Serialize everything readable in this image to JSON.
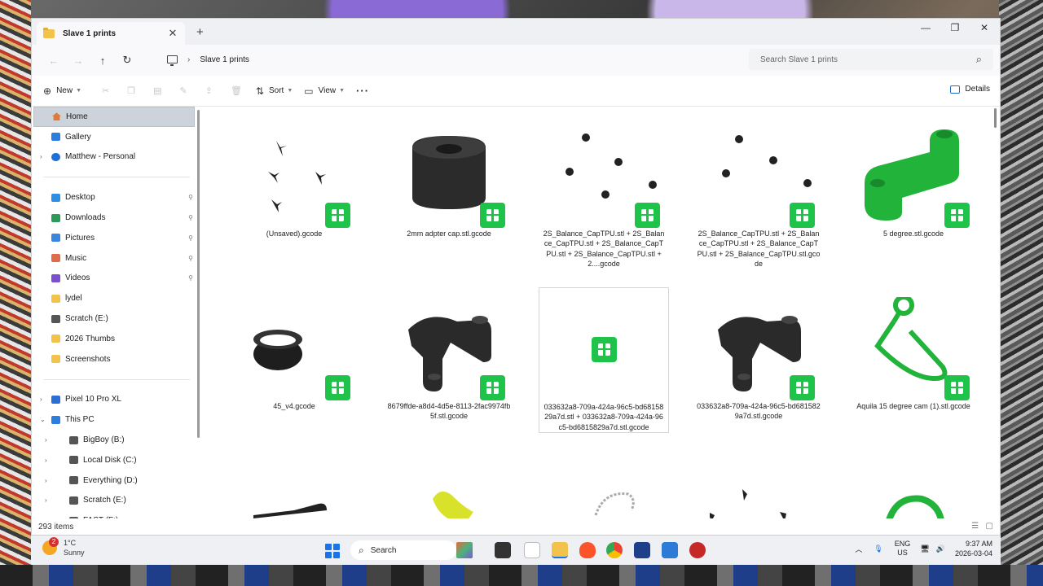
{
  "window": {
    "tab_title": "Slave 1 prints",
    "breadcrumb": "Slave 1 prints",
    "search_placeholder": "Search Slave 1 prints",
    "icons": {
      "tab_close": "✕",
      "new_tab": "+",
      "minimize": "—",
      "maximize": "❐",
      "close": "✕",
      "back": "←",
      "forward": "→",
      "up": "↑",
      "refresh": "↻",
      "search": "⌕"
    }
  },
  "toolbar": {
    "new_label": "New",
    "sort_label": "Sort",
    "view_label": "View",
    "more_label": "···",
    "details_label": "Details"
  },
  "sidebar": {
    "items": [
      {
        "label": "Home",
        "icon": "home-icon",
        "color": "#e07a3a"
      },
      {
        "label": "Gallery",
        "icon": "gallery-icon",
        "color": "#2b7de0"
      },
      {
        "label": "Matthew - Personal",
        "icon": "cloud-icon",
        "color": "#1f6fd6",
        "arrow": "›"
      }
    ],
    "quick": [
      {
        "label": "Desktop",
        "color": "#2e8ee6",
        "pin": "📌"
      },
      {
        "label": "Downloads",
        "color": "#2b9a5b",
        "pin": "📌"
      },
      {
        "label": "Pictures",
        "color": "#3a85e0",
        "pin": "📌"
      },
      {
        "label": "Music",
        "color": "#e06b4a",
        "pin": "📌"
      },
      {
        "label": "Videos",
        "color": "#7a4fd0",
        "pin": "📌"
      },
      {
        "label": "lydel",
        "color": "#f2c24a"
      },
      {
        "label": "Scratch (E:)",
        "color": "#555555"
      },
      {
        "label": "2026 Thumbs",
        "color": "#f2c24a"
      },
      {
        "label": "Screenshots",
        "color": "#f2c24a"
      }
    ],
    "devices": [
      {
        "label": "Pixel 10 Pro XL",
        "color": "#2b6fd6",
        "arrow": "›"
      },
      {
        "label": "This PC",
        "color": "#2b7de0",
        "arrow": "⌄"
      },
      {
        "label": "BigBoy (B:)",
        "color": "#555555",
        "arrow": "›"
      },
      {
        "label": "Local Disk (C:)",
        "color": "#555555",
        "arrow": "›"
      },
      {
        "label": "Everything (D:)",
        "color": "#555555",
        "arrow": "›"
      },
      {
        "label": "Scratch (E:)",
        "color": "#555555",
        "arrow": "›"
      },
      {
        "label": "FAST (F:)",
        "color": "#555555",
        "arrow": "›"
      }
    ]
  },
  "files": [
    {
      "name": "(Unsaved).gcode",
      "thumb": "parts"
    },
    {
      "name": "2mm adpter cap.stl.gcode",
      "thumb": "cylinder"
    },
    {
      "name": "2S_Balance_CapTPU.stl + 2S_Balance_CapTPU.stl + 2S_Balance_CapTPU.stl + 2S_Balance_CapTPU.stl + 2....gcode",
      "thumb": "dots"
    },
    {
      "name": "2S_Balance_CapTPU.stl + 2S_Balance_CapTPU.stl + 2S_Balance_CapTPU.stl + 2S_Balance_CapTPU.stl.gcode",
      "thumb": "dots2"
    },
    {
      "name": "5 degree.stl.gcode",
      "thumb": "bracket"
    },
    {
      "name": "45_v4.gcode",
      "thumb": "ring"
    },
    {
      "name": "8679ffde-a8d4-4d5e-8113-2fac9974fb5f.stl.gcode",
      "thumb": "mount"
    },
    {
      "name": "033632a8-709a-424a-96c5-bd6815829a7d.stl + 033632a8-709a-424a-96c5-bd6815829a7d.stl.gcode",
      "thumb": "empty"
    },
    {
      "name": "033632a8-709a-424a-96c5-bd6815829a7d.stl.gcode",
      "thumb": "mount"
    },
    {
      "name": "Aquila 15 degree cam (1).stl.gcode",
      "thumb": "cam"
    }
  ],
  "status": {
    "item_count": "293 items"
  },
  "taskbar": {
    "temp": "1°C",
    "condition": "Sunny",
    "weather_badge": "2",
    "search_label": "Search",
    "lang1": "ENG",
    "lang2": "US",
    "time": "9:37 AM",
    "date": "2026-03-04"
  }
}
